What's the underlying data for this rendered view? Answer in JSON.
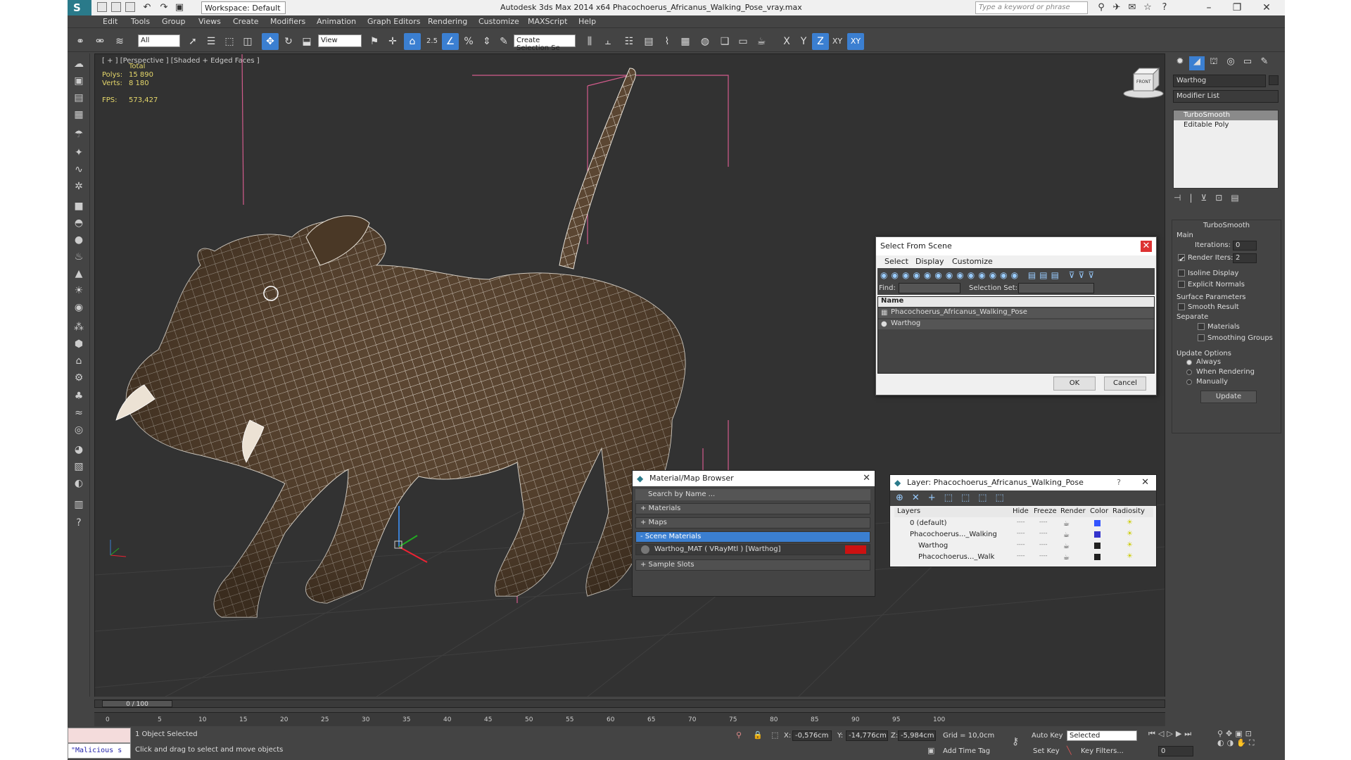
{
  "title": "Autodesk 3ds Max  2014 x64    Phacochoerus_Africanus_Walking_Pose_vray.max",
  "workspace": "Workspace: Default",
  "search_placeholder": "Type a keyword or phrase",
  "menu": [
    "Edit",
    "Tools",
    "Group",
    "Views",
    "Create",
    "Modifiers",
    "Animation",
    "Graph Editors",
    "Rendering",
    "Customize",
    "MAXScript",
    "Help"
  ],
  "toolbar": {
    "filter": "All",
    "refcoord": "View",
    "snap_label": "2.5",
    "named_sel": "Create Selection Se",
    "axis_x": "X",
    "axis_y": "Y",
    "axis_z": "Z",
    "axis_xy": "XY",
    "axis_xy2": "XY"
  },
  "viewport": {
    "label": "[ + ] [Perspective ] [Shaded + Edged Faces ]",
    "stats": {
      "total": "Total",
      "polys_label": "Polys:",
      "polys": "15 890",
      "verts_label": "Verts:",
      "verts": "8 180",
      "fps_label": "FPS:",
      "fps": "573,427"
    },
    "viewcube_label": "FRONT"
  },
  "command_panel": {
    "object_name": "Warthog",
    "modifier_list": "Modifier List",
    "stack": [
      "TurboSmooth",
      "Editable Poly"
    ],
    "rollout_title": "TurboSmooth",
    "main": "Main",
    "iterations_label": "Iterations:",
    "iterations": "0",
    "render_iters_label": "Render Iters:",
    "render_iters": "2",
    "isoline": "Isoline Display",
    "explicit_normals": "Explicit Normals",
    "surface_params": "Surface Parameters",
    "smooth_result": "Smooth Result",
    "separate": "Separate",
    "materials": "Materials",
    "smoothing_groups": "Smoothing Groups",
    "update_options": "Update Options",
    "always": "Always",
    "when_rendering": "When Rendering",
    "manually": "Manually",
    "update": "Update"
  },
  "select_from_scene": {
    "title": "Select From Scene",
    "menu": [
      "Select",
      "Display",
      "Customize"
    ],
    "find_label": "Find:",
    "selection_set_label": "Selection Set:",
    "col_name": "Name",
    "rows": [
      "Phacochoerus_Africanus_Walking_Pose",
      "Warthog"
    ],
    "ok": "OK",
    "cancel": "Cancel"
  },
  "material_browser": {
    "title": "Material/Map Browser",
    "search": "Search by Name ...",
    "rows": [
      "+ Materials",
      "+ Maps",
      "- Scene Materials",
      "+ Sample Slots"
    ],
    "material": "Warthog_MAT  ( VRayMtl )  [Warthog]"
  },
  "layer_dialog": {
    "title": "Layer: Phacochoerus_Africanus_Walking_Pose",
    "help": "?",
    "cols": [
      "Layers",
      "Hide",
      "Freeze",
      "Render",
      "Color",
      "Radiosity"
    ],
    "rows": [
      "0 (default)",
      "Phacochoerus..._Walking",
      "Warthog",
      "Phacochoerus..._Walk"
    ],
    "dots": "----"
  },
  "timeline": {
    "frame": "0 / 100",
    "ticks": [
      "0",
      "5",
      "10",
      "15",
      "20",
      "25",
      "30",
      "35",
      "40",
      "45",
      "50",
      "55",
      "60",
      "65",
      "70",
      "75",
      "80",
      "85",
      "90",
      "95",
      "100"
    ]
  },
  "status": {
    "script": "\"Malicious s",
    "selected": "1 Object Selected",
    "prompt": "Click and drag to select and move objects",
    "x_label": "X:",
    "x": "-0,576cm",
    "y_label": "Y:",
    "y": "-14,776cm",
    "z_label": "Z:",
    "z": "-5,984cm",
    "grid": "Grid = 10,0cm",
    "auto_key": "Auto Key",
    "key_mode": "Selected",
    "set_key": "Set Key",
    "key_filters": "Key Filters...",
    "add_time_tag": "Add Time Tag",
    "current_frame": "0"
  },
  "colors": {
    "accent": "#3b7fd1",
    "viewport_bg": "#323232",
    "stats": "#e5d76a",
    "gizmo_pink": "#d25b8c"
  }
}
